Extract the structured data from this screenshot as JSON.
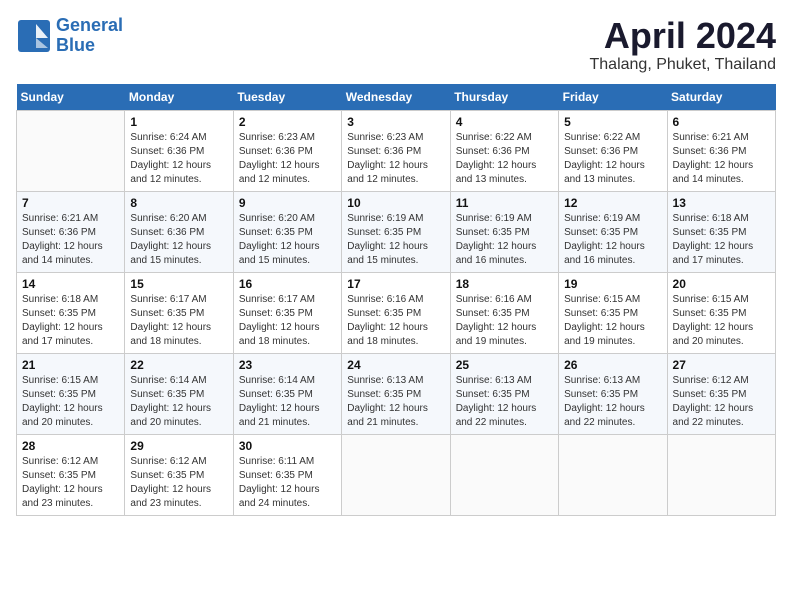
{
  "header": {
    "logo_line1": "General",
    "logo_line2": "Blue",
    "title": "April 2024",
    "location": "Thalang, Phuket, Thailand"
  },
  "calendar": {
    "days_of_week": [
      "Sunday",
      "Monday",
      "Tuesday",
      "Wednesday",
      "Thursday",
      "Friday",
      "Saturday"
    ],
    "weeks": [
      [
        {
          "day": "",
          "info": ""
        },
        {
          "day": "1",
          "info": "Sunrise: 6:24 AM\nSunset: 6:36 PM\nDaylight: 12 hours\nand 12 minutes."
        },
        {
          "day": "2",
          "info": "Sunrise: 6:23 AM\nSunset: 6:36 PM\nDaylight: 12 hours\nand 12 minutes."
        },
        {
          "day": "3",
          "info": "Sunrise: 6:23 AM\nSunset: 6:36 PM\nDaylight: 12 hours\nand 12 minutes."
        },
        {
          "day": "4",
          "info": "Sunrise: 6:22 AM\nSunset: 6:36 PM\nDaylight: 12 hours\nand 13 minutes."
        },
        {
          "day": "5",
          "info": "Sunrise: 6:22 AM\nSunset: 6:36 PM\nDaylight: 12 hours\nand 13 minutes."
        },
        {
          "day": "6",
          "info": "Sunrise: 6:21 AM\nSunset: 6:36 PM\nDaylight: 12 hours\nand 14 minutes."
        }
      ],
      [
        {
          "day": "7",
          "info": "Sunrise: 6:21 AM\nSunset: 6:36 PM\nDaylight: 12 hours\nand 14 minutes."
        },
        {
          "day": "8",
          "info": "Sunrise: 6:20 AM\nSunset: 6:36 PM\nDaylight: 12 hours\nand 15 minutes."
        },
        {
          "day": "9",
          "info": "Sunrise: 6:20 AM\nSunset: 6:35 PM\nDaylight: 12 hours\nand 15 minutes."
        },
        {
          "day": "10",
          "info": "Sunrise: 6:19 AM\nSunset: 6:35 PM\nDaylight: 12 hours\nand 15 minutes."
        },
        {
          "day": "11",
          "info": "Sunrise: 6:19 AM\nSunset: 6:35 PM\nDaylight: 12 hours\nand 16 minutes."
        },
        {
          "day": "12",
          "info": "Sunrise: 6:19 AM\nSunset: 6:35 PM\nDaylight: 12 hours\nand 16 minutes."
        },
        {
          "day": "13",
          "info": "Sunrise: 6:18 AM\nSunset: 6:35 PM\nDaylight: 12 hours\nand 17 minutes."
        }
      ],
      [
        {
          "day": "14",
          "info": "Sunrise: 6:18 AM\nSunset: 6:35 PM\nDaylight: 12 hours\nand 17 minutes."
        },
        {
          "day": "15",
          "info": "Sunrise: 6:17 AM\nSunset: 6:35 PM\nDaylight: 12 hours\nand 18 minutes."
        },
        {
          "day": "16",
          "info": "Sunrise: 6:17 AM\nSunset: 6:35 PM\nDaylight: 12 hours\nand 18 minutes."
        },
        {
          "day": "17",
          "info": "Sunrise: 6:16 AM\nSunset: 6:35 PM\nDaylight: 12 hours\nand 18 minutes."
        },
        {
          "day": "18",
          "info": "Sunrise: 6:16 AM\nSunset: 6:35 PM\nDaylight: 12 hours\nand 19 minutes."
        },
        {
          "day": "19",
          "info": "Sunrise: 6:15 AM\nSunset: 6:35 PM\nDaylight: 12 hours\nand 19 minutes."
        },
        {
          "day": "20",
          "info": "Sunrise: 6:15 AM\nSunset: 6:35 PM\nDaylight: 12 hours\nand 20 minutes."
        }
      ],
      [
        {
          "day": "21",
          "info": "Sunrise: 6:15 AM\nSunset: 6:35 PM\nDaylight: 12 hours\nand 20 minutes."
        },
        {
          "day": "22",
          "info": "Sunrise: 6:14 AM\nSunset: 6:35 PM\nDaylight: 12 hours\nand 20 minutes."
        },
        {
          "day": "23",
          "info": "Sunrise: 6:14 AM\nSunset: 6:35 PM\nDaylight: 12 hours\nand 21 minutes."
        },
        {
          "day": "24",
          "info": "Sunrise: 6:13 AM\nSunset: 6:35 PM\nDaylight: 12 hours\nand 21 minutes."
        },
        {
          "day": "25",
          "info": "Sunrise: 6:13 AM\nSunset: 6:35 PM\nDaylight: 12 hours\nand 22 minutes."
        },
        {
          "day": "26",
          "info": "Sunrise: 6:13 AM\nSunset: 6:35 PM\nDaylight: 12 hours\nand 22 minutes."
        },
        {
          "day": "27",
          "info": "Sunrise: 6:12 AM\nSunset: 6:35 PM\nDaylight: 12 hours\nand 22 minutes."
        }
      ],
      [
        {
          "day": "28",
          "info": "Sunrise: 6:12 AM\nSunset: 6:35 PM\nDaylight: 12 hours\nand 23 minutes."
        },
        {
          "day": "29",
          "info": "Sunrise: 6:12 AM\nSunset: 6:35 PM\nDaylight: 12 hours\nand 23 minutes."
        },
        {
          "day": "30",
          "info": "Sunrise: 6:11 AM\nSunset: 6:35 PM\nDaylight: 12 hours\nand 24 minutes."
        },
        {
          "day": "",
          "info": ""
        },
        {
          "day": "",
          "info": ""
        },
        {
          "day": "",
          "info": ""
        },
        {
          "day": "",
          "info": ""
        }
      ]
    ]
  }
}
